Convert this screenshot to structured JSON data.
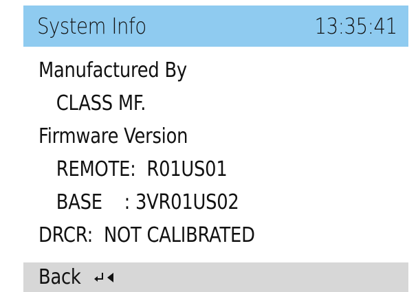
{
  "header": {
    "title": "System Info",
    "time": "13:35:41",
    "background": "#8fcbf0"
  },
  "info": {
    "manufacturer_label": "Manufactured By",
    "manufacturer_value": "CLASS MF.",
    "firmware_label": "Firmware Version",
    "remote_line": "REMOTE:  R01US01",
    "base_line": "BASE    : 3VR01US02",
    "drcr_line": "DRCR:  NOT CALIBRATED"
  },
  "footer": {
    "back_label": "Back",
    "back_icons": [
      "enter-icon",
      "left-triangle-icon"
    ],
    "background": "#d7d7d7"
  }
}
